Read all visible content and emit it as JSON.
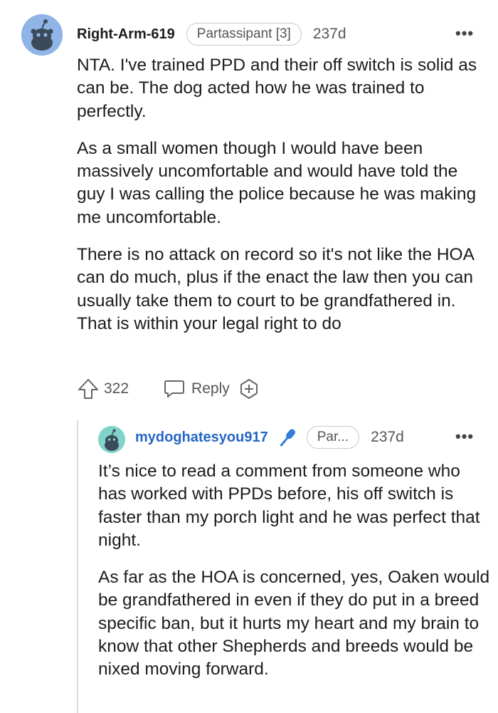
{
  "comment": {
    "username": "Right-Arm-619",
    "flair": "Partassipant [3]",
    "age": "237d",
    "more_label": "•••",
    "paragraphs": [
      "NTA. I've trained PPD and their off switch is solid as can be. The dog acted how he was trained to perfectly.",
      "As a small women though I would have been massively uncomfortable and would have told the guy I was calling the police because he was making me uncomfortable.",
      "There is no attack on record so it's not like the HOA can do much, plus if the enact the law then you can usually take them to court to be grandfathered in. That is within your legal right to do"
    ],
    "score": "322",
    "reply_label": "Reply",
    "icons": {
      "avatar": "snoo-avatar-icon",
      "upvote": "upvote-arrow-icon",
      "reply": "reply-bubble-icon",
      "award": "award-plus-icon",
      "more": "more-dots-icon"
    }
  },
  "reply": {
    "username": "mydoghatesyou917",
    "flair": "Par...",
    "age": "237d",
    "more_label": "•••",
    "paragraphs": [
      "It’s nice to read a comment from someone who has worked with PPDs before, his off switch is faster than my porch light and he was perfect that night.",
      "As far as the HOA is concerned, yes, Oaken would be grandfathered in even if they do put in a breed specific ban, but it hurts my heart and my brain to know that other Shepherds and breeds would be nixed moving forward."
    ],
    "icons": {
      "avatar": "snoo-avatar-icon",
      "op_badge": "microphone-icon",
      "more": "more-dots-icon"
    }
  },
  "colors": {
    "text": "#1c1c1c",
    "muted": "#555555",
    "op_username": "#2466c4",
    "avatar_1": "#8fb4e6",
    "avatar_2": "#7fd3c9",
    "mic": "#2f7ed8"
  }
}
